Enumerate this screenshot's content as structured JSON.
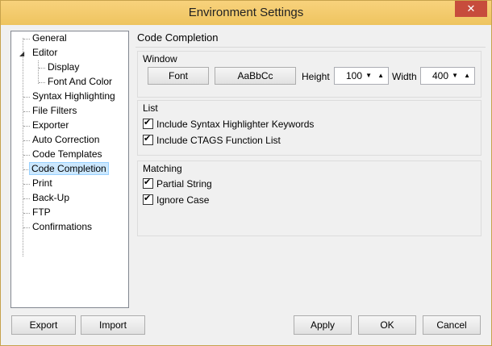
{
  "window": {
    "title": "Environment Settings",
    "close_glyph": "✕"
  },
  "tree": {
    "items": [
      {
        "label": "General"
      },
      {
        "label": "Editor",
        "expander": "◢"
      },
      {
        "label": "Display"
      },
      {
        "label": "Font And Color"
      },
      {
        "label": "Syntax Highlighting"
      },
      {
        "label": "File Filters"
      },
      {
        "label": "Exporter"
      },
      {
        "label": "Auto Correction"
      },
      {
        "label": "Code Templates"
      },
      {
        "label": "Code Completion",
        "selected": true
      },
      {
        "label": "Print"
      },
      {
        "label": "Back-Up"
      },
      {
        "label": "FTP"
      },
      {
        "label": "Confirmations"
      }
    ]
  },
  "panel": {
    "title": "Code Completion",
    "window_group": {
      "label": "Window",
      "font_button": "Font",
      "font_preview": "AaBbCc",
      "height_label": "Height",
      "height_value": "100",
      "width_label": "Width",
      "width_value": "400",
      "down_glyph": "▼",
      "up_glyph": "▲"
    },
    "list_group": {
      "label": "List",
      "options": [
        {
          "label": "Include Syntax Highlighter Keywords",
          "checked": true
        },
        {
          "label": "Include CTAGS Function List",
          "checked": true
        }
      ]
    },
    "matching_group": {
      "label": "Matching",
      "options": [
        {
          "label": "Partial String",
          "checked": true
        },
        {
          "label": "Ignore Case",
          "checked": true
        }
      ]
    }
  },
  "footer": {
    "export": "Export",
    "import": "Import",
    "apply": "Apply",
    "ok": "OK",
    "cancel": "Cancel"
  },
  "check_glyph": "✔"
}
